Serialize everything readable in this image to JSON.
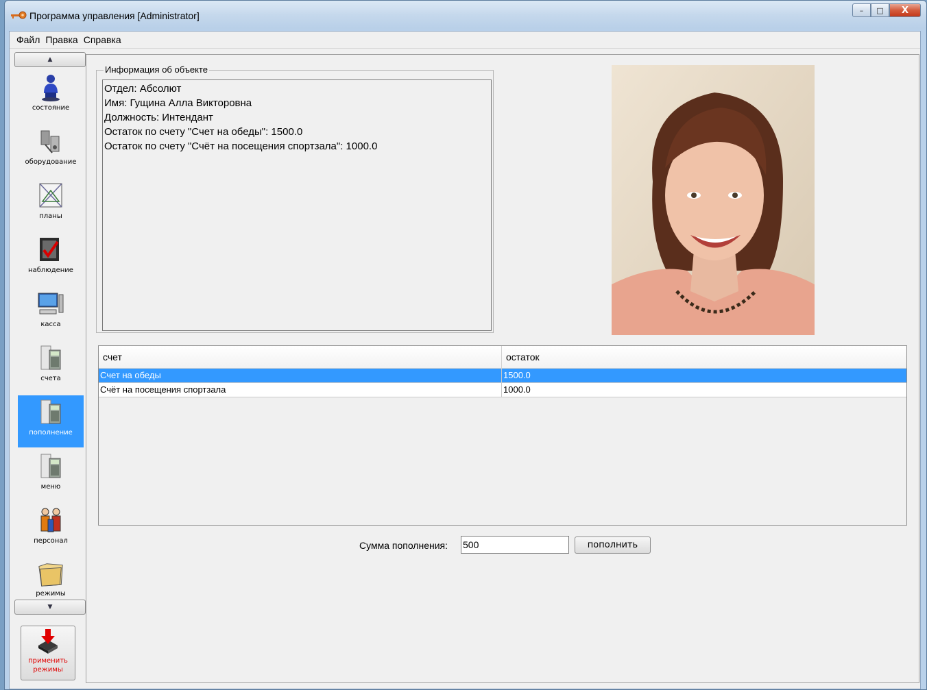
{
  "window": {
    "title": "Программа управления [Administrator]",
    "minimize": "–",
    "maximize": "□",
    "close": "X"
  },
  "menu": [
    "Файл",
    "Правка",
    "Справка"
  ],
  "sidebar": {
    "items": [
      {
        "label": "состояние",
        "icon": "person-icon"
      },
      {
        "label": "оборудование",
        "icon": "equipment-icon"
      },
      {
        "label": "планы",
        "icon": "plans-icon"
      },
      {
        "label": "наблюдение",
        "icon": "monitoring-icon"
      },
      {
        "label": "касса",
        "icon": "computer-icon"
      },
      {
        "label": "счета",
        "icon": "calculator-icon"
      },
      {
        "label": "пополнение",
        "icon": "calculator-icon",
        "active": true
      },
      {
        "label": "меню",
        "icon": "calculator-icon"
      },
      {
        "label": "персонал",
        "icon": "people-icon"
      },
      {
        "label": "режимы",
        "icon": "folder-icon"
      }
    ],
    "apply_label_1": "применить",
    "apply_label_2": "режимы"
  },
  "info": {
    "title": "Информация об объекте",
    "lines": [
      "Отдел: Абсолют",
      "Имя: Гущина Алла Викторовна",
      "Должность: Интендант",
      "Остаток по счету \"Счет на обеды\": 1500.0",
      "Остаток по счету \"Счёт на посещения спортзала\": 1000.0"
    ]
  },
  "table": {
    "columns": [
      "счет",
      "остаток"
    ],
    "rows": [
      [
        "Счет на обеды",
        "1500.0"
      ],
      [
        "Счёт на посещения спортзала",
        "1000.0"
      ]
    ],
    "selected_row": 0
  },
  "topup": {
    "label": "Сумма пополнения:",
    "value": "500",
    "button": "пополнить"
  },
  "colors": {
    "selection": "#3399ff",
    "apply_text": "#e00000"
  }
}
